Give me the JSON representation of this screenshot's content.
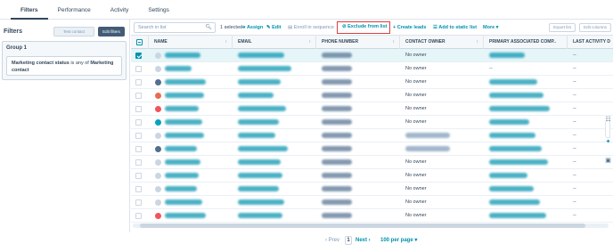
{
  "tabs": [
    {
      "label": "Filters",
      "active": true
    },
    {
      "label": "Performance",
      "active": false
    },
    {
      "label": "Activity",
      "active": false
    },
    {
      "label": "Settings",
      "active": false
    }
  ],
  "left_panel": {
    "title": "Filters",
    "test_contact_label": "Test contact",
    "edit_filters_label": "Edit filters",
    "group_title": "Group 1",
    "condition_part1": "Marketing contact status",
    "condition_part2": " is any of ",
    "condition_part3": "Marketing contact"
  },
  "toolbar": {
    "search_placeholder": "Search in list",
    "selected_text": "1 selected",
    "assign_label": "Assign",
    "edit_label": "Edit",
    "enroll_label": "Enroll in sequence",
    "exclude_label": "Exclude from list",
    "create_leads_label": "Create leads",
    "add_static_label": "Add to static list",
    "more_label": "More",
    "export_label": "Export list",
    "edit_columns_label": "Edit columns"
  },
  "columns": [
    "NAME",
    "EMAIL",
    "PHONE NUMBER",
    "CONTACT OWNER",
    "PRIMARY ASSOCIATED COMP..",
    "LAST ACTIVITY D"
  ],
  "rows": [
    {
      "selected": true,
      "owner": "No owner",
      "company": "",
      "last": "--",
      "avatar": "#cbd6e2"
    },
    {
      "selected": false,
      "owner": "No owner",
      "company": "--",
      "last": "--",
      "avatar": "#cbd6e2"
    },
    {
      "selected": false,
      "owner": "No owner",
      "company": "",
      "last": "--",
      "avatar": "#516f90"
    },
    {
      "selected": false,
      "owner": "No owner",
      "company": "",
      "last": "--",
      "avatar": "#e66e50"
    },
    {
      "selected": false,
      "owner": "No owner",
      "company": "",
      "last": "--",
      "avatar": "#f2545b"
    },
    {
      "selected": false,
      "owner": "No owner",
      "company": "",
      "last": "--",
      "avatar": "#00a4bd"
    },
    {
      "selected": false,
      "owner": "",
      "company": "",
      "last": "--",
      "avatar": "#cbd6e2"
    },
    {
      "selected": false,
      "owner": "",
      "company": "",
      "last": "--",
      "avatar": "#516f90"
    },
    {
      "selected": false,
      "owner": "No owner",
      "company": "",
      "last": "--",
      "avatar": "#cbd6e2"
    },
    {
      "selected": false,
      "owner": "No owner",
      "company": "",
      "last": "--",
      "avatar": "#cbd6e2"
    },
    {
      "selected": false,
      "owner": "No owner",
      "company": "",
      "last": "--",
      "avatar": "#cbd6e2"
    },
    {
      "selected": false,
      "owner": "No owner",
      "company": "",
      "last": "--",
      "avatar": "#cbd6e2"
    },
    {
      "selected": false,
      "owner": "No owner",
      "company": "",
      "last": "--",
      "avatar": "#f2545b"
    }
  ],
  "pager": {
    "prev_label": "Prev",
    "current_page": "1",
    "next_label": "Next",
    "per_page_label": "100 per page"
  },
  "colors": {
    "accent": "#0091ae",
    "highlight_border": "#e03c3c",
    "dark_button": "#425b76"
  }
}
